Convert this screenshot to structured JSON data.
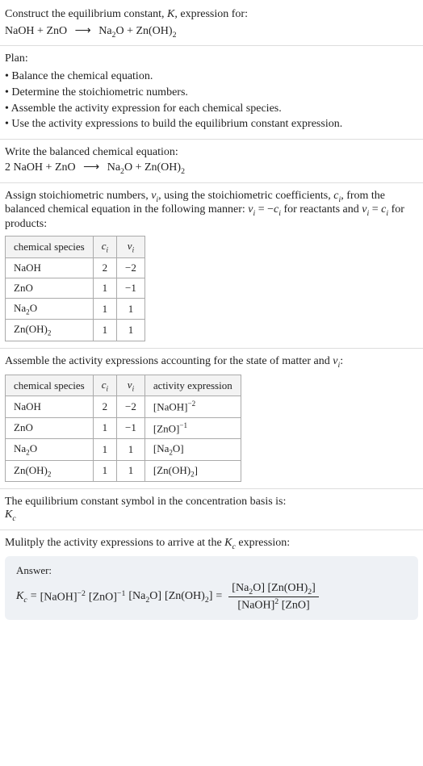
{
  "header": {
    "prompt_line1": "Construct the equilibrium constant, ",
    "K": "K",
    "prompt_line1_tail": ", expression for:",
    "reactant1": "NaOH",
    "plus": "+",
    "reactant2": "ZnO",
    "arrow": "⟶",
    "product1_a": "Na",
    "product1_sub": "2",
    "product1_b": "O",
    "product2_a": "Zn(OH)",
    "product2_sub": "2"
  },
  "plan": {
    "title": "Plan:",
    "items": [
      "Balance the chemical equation.",
      "Determine the stoichiometric numbers.",
      "Assemble the activity expression for each chemical species.",
      "Use the activity expressions to build the equilibrium constant expression."
    ]
  },
  "balanced": {
    "title": "Write the balanced chemical equation:",
    "coef1": "2",
    "r1": "NaOH",
    "plus": "+",
    "r2": "ZnO",
    "arrow": "⟶",
    "p1a": "Na",
    "p1s": "2",
    "p1b": "O",
    "p2a": "Zn(OH)",
    "p2s": "2"
  },
  "stoich": {
    "intro_a": "Assign stoichiometric numbers, ",
    "nu": "ν",
    "sub_i": "i",
    "intro_b": ", using the stoichiometric coefficients, ",
    "c": "c",
    "intro_c": ", from the balanced chemical equation in the following manner: ",
    "eq1": "ν",
    "eq1b": " = −",
    "eq1c": "c",
    "intro_d": " for reactants and ",
    "eq2": "ν",
    "eq2b": " = ",
    "eq2c": "c",
    "intro_e": " for products:",
    "headers": {
      "species": "chemical species",
      "ci": "c",
      "nui": "ν"
    },
    "rows": [
      {
        "species": "NaOH",
        "ci": "2",
        "nui": "−2"
      },
      {
        "species": "ZnO",
        "ci": "1",
        "nui": "−1"
      },
      {
        "species_a": "Na",
        "species_sub": "2",
        "species_b": "O",
        "ci": "1",
        "nui": "1"
      },
      {
        "species_a": "Zn(OH)",
        "species_sub": "2",
        "species_b": "",
        "ci": "1",
        "nui": "1"
      }
    ]
  },
  "activity": {
    "intro_a": "Assemble the activity expressions accounting for the state of matter and ",
    "nu": "ν",
    "sub_i": "i",
    "intro_b": ":",
    "headers": {
      "species": "chemical species",
      "ci": "c",
      "nui": "ν",
      "act": "activity expression"
    },
    "rows": [
      {
        "species": "NaOH",
        "ci": "2",
        "nui": "−2",
        "act_base": "[NaOH]",
        "act_exp": "−2"
      },
      {
        "species": "ZnO",
        "ci": "1",
        "nui": "−1",
        "act_base": "[ZnO]",
        "act_exp": "−1"
      },
      {
        "species_a": "Na",
        "species_sub": "2",
        "species_b": "O",
        "ci": "1",
        "nui": "1",
        "act_pre": "[Na",
        "act_sub": "2",
        "act_post": "O]"
      },
      {
        "species_a": "Zn(OH)",
        "species_sub": "2",
        "species_b": "",
        "ci": "1",
        "nui": "1",
        "act_pre": "[Zn(OH)",
        "act_sub": "2",
        "act_post": "]"
      }
    ]
  },
  "symbol": {
    "line1": "The equilibrium constant symbol in the concentration basis is:",
    "K": "K",
    "sub": "c"
  },
  "multiply": {
    "line_a": "Mulitply the activity expressions to arrive at the ",
    "K": "K",
    "sub": "c",
    "line_b": " expression:"
  },
  "answer": {
    "label": "Answer:",
    "Kc_K": "K",
    "Kc_sub": "c",
    "eq": " = ",
    "t1_base": "[NaOH]",
    "t1_exp": "−2",
    "t2_base": "[ZnO]",
    "t2_exp": "−1",
    "t3_pre": "[Na",
    "t3_sub": "2",
    "t3_post": "O]",
    "t4_pre": "[Zn(OH)",
    "t4_sub": "2",
    "t4_post": "]",
    "eq2": " = ",
    "num_a_pre": "[Na",
    "num_a_sub": "2",
    "num_a_post": "O]",
    "num_b_pre": "[Zn(OH)",
    "num_b_sub": "2",
    "num_b_post": "]",
    "den_a_base": "[NaOH]",
    "den_a_exp": "2",
    "den_b": "[ZnO]"
  },
  "chart_data": {
    "type": "table",
    "tables": [
      {
        "title": "stoichiometric numbers",
        "columns": [
          "chemical species",
          "c_i",
          "ν_i"
        ],
        "rows": [
          [
            "NaOH",
            2,
            -2
          ],
          [
            "ZnO",
            1,
            -1
          ],
          [
            "Na2O",
            1,
            1
          ],
          [
            "Zn(OH)2",
            1,
            1
          ]
        ]
      },
      {
        "title": "activity expressions",
        "columns": [
          "chemical species",
          "c_i",
          "ν_i",
          "activity expression"
        ],
        "rows": [
          [
            "NaOH",
            2,
            -2,
            "[NaOH]^-2"
          ],
          [
            "ZnO",
            1,
            -1,
            "[ZnO]^-1"
          ],
          [
            "Na2O",
            1,
            1,
            "[Na2O]"
          ],
          [
            "Zn(OH)2",
            1,
            1,
            "[Zn(OH)2]"
          ]
        ]
      }
    ]
  }
}
